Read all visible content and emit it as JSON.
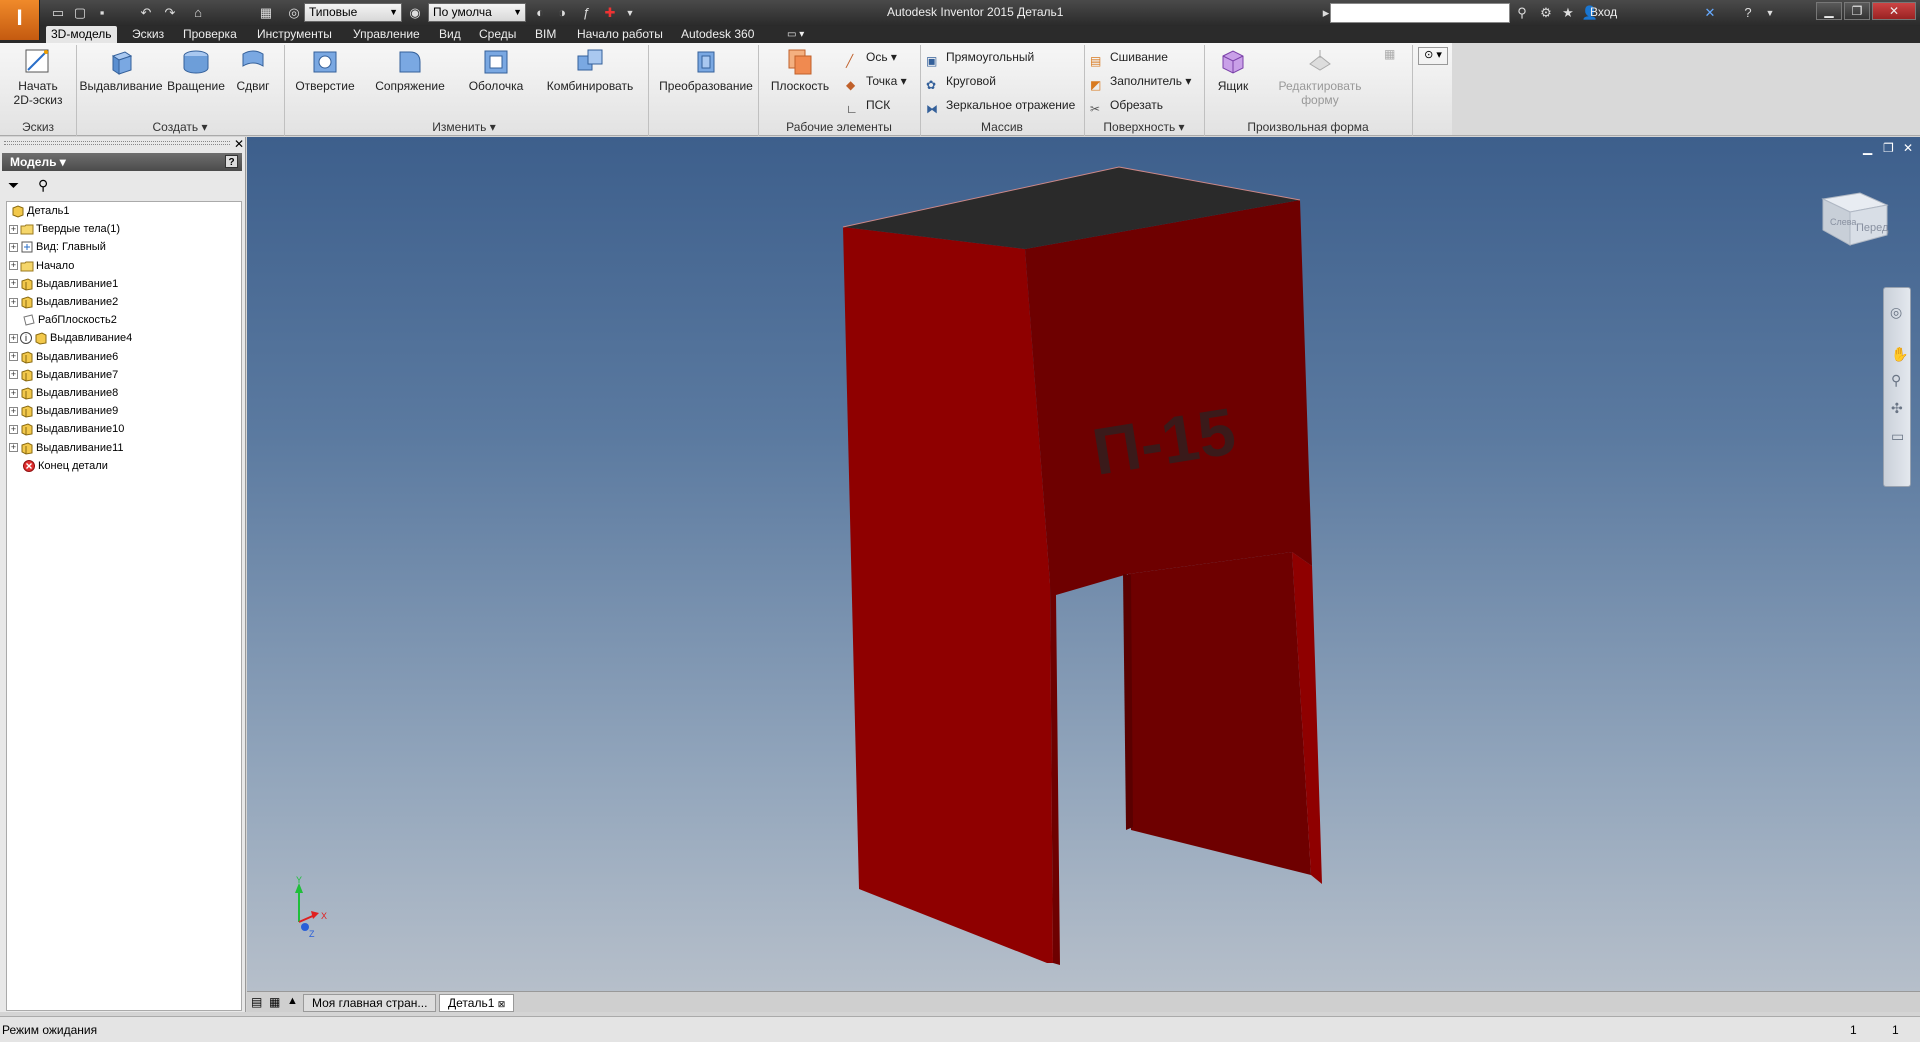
{
  "app": {
    "title": "Autodesk Inventor 2015   Деталь1",
    "logo_letter": "I",
    "appearance_select": "Типовые",
    "material_select": "По умолча",
    "login": "Вход"
  },
  "tabs": [
    {
      "label": "3D-модель",
      "active": true
    },
    {
      "label": "Эскиз"
    },
    {
      "label": "Проверка"
    },
    {
      "label": "Инструменты"
    },
    {
      "label": "Управление"
    },
    {
      "label": "Вид"
    },
    {
      "label": "Среды"
    },
    {
      "label": "BIM"
    },
    {
      "label": "Начало работы"
    },
    {
      "label": "Autodesk 360"
    }
  ],
  "ribbon": {
    "sketch": {
      "start_label": "Начать",
      "start_label2": "2D-эскиз",
      "panel": "Эскиз"
    },
    "create": {
      "extrude": "Выдавливание",
      "revolve": "Вращение",
      "sweep": "Сдвиг",
      "panel": "Создать"
    },
    "modify": {
      "hole": "Отверстие",
      "fillet": "Сопряжение",
      "shell": "Оболочка",
      "combine": "Комбинировать",
      "panel": "Изменить"
    },
    "transform": {
      "label": "Преобразование"
    },
    "work_features": {
      "plane": "Плоскость",
      "axis": "Ось",
      "point": "Точка",
      "ucs": "ПСК",
      "panel": "Рабочие элементы"
    },
    "pattern": {
      "rect": "Прямоугольный",
      "circular": "Круговой",
      "mirror": "Зеркальное отражение",
      "panel": "Массив"
    },
    "surface": {
      "stitch": "Сшивание",
      "patch": "Заполнитель",
      "trim": "Обрезать",
      "panel": "Поверхность"
    },
    "freeform": {
      "box": "Ящик",
      "edit": "Редактировать",
      "edit2": "форму",
      "panel": "Произвольная форма"
    }
  },
  "browser": {
    "title": "Модель",
    "items": [
      {
        "label": "Деталь1",
        "level": 0,
        "icon": "part-icon",
        "expander": false
      },
      {
        "label": "Твердые тела(1)",
        "level": 1,
        "icon": "folder-icon",
        "expander": true
      },
      {
        "label": "Вид: Главный",
        "level": 1,
        "icon": "view-icon",
        "expander": true
      },
      {
        "label": "Начало",
        "level": 1,
        "icon": "folder-icon",
        "expander": true
      },
      {
        "label": "Выдавливание1",
        "level": 1,
        "icon": "extrude-icon",
        "expander": true
      },
      {
        "label": "Выдавливание2",
        "level": 1,
        "icon": "extrude-icon",
        "expander": true
      },
      {
        "label": "РабПлоскость2",
        "level": 1,
        "icon": "workplane-icon",
        "expander": false
      },
      {
        "label": "Выдавливание4",
        "level": 1,
        "icon": "extrude-warning-icon",
        "expander": true
      },
      {
        "label": "Выдавливание6",
        "level": 1,
        "icon": "extrude-icon",
        "expander": true
      },
      {
        "label": "Выдавливание7",
        "level": 1,
        "icon": "extrude-icon",
        "expander": true
      },
      {
        "label": "Выдавливание8",
        "level": 1,
        "icon": "extrude-icon",
        "expander": true
      },
      {
        "label": "Выдавливание9",
        "level": 1,
        "icon": "extrude-icon",
        "expander": true
      },
      {
        "label": "Выдавливание10",
        "level": 1,
        "icon": "extrude-icon",
        "expander": true
      },
      {
        "label": "Выдавливание11",
        "level": 1,
        "icon": "extrude-icon",
        "expander": true
      },
      {
        "label": "Конец детали",
        "level": 1,
        "icon": "end-of-part-icon",
        "expander": false
      }
    ]
  },
  "viewport": {
    "model_text": "П-15",
    "viewcube_left": "Слева",
    "viewcube_front": "Перед",
    "triad": {
      "y": "Y",
      "x": "X",
      "z": "Z"
    },
    "colors": {
      "body": "#8f0000",
      "body_dark": "#6e0000",
      "top": "#2a2a2a"
    }
  },
  "doc_tabs": [
    {
      "label": "Моя главная стран..."
    },
    {
      "label": "Деталь1",
      "active": true
    }
  ],
  "status": {
    "text": "Режим ожидания",
    "num1": "1",
    "num2": "1"
  }
}
